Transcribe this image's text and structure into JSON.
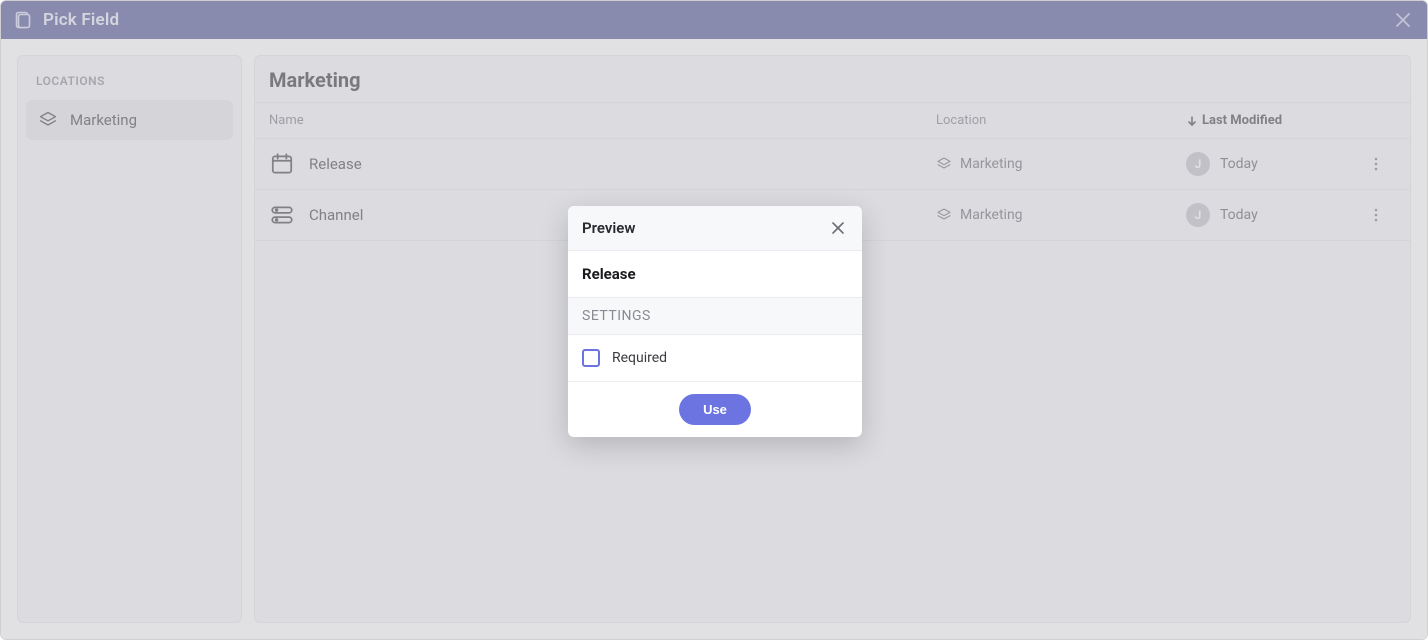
{
  "titlebar": {
    "title": "Pick Field"
  },
  "sidebar": {
    "header": "LOCATIONS",
    "items": [
      {
        "label": "Marketing"
      }
    ]
  },
  "main": {
    "heading": "Marketing",
    "columns": {
      "name": "Name",
      "location": "Location",
      "lastModified": "Last Modified"
    },
    "rows": [
      {
        "name": "Release",
        "icon": "date",
        "location": "Marketing",
        "modified": "Today",
        "avatar": "J"
      },
      {
        "name": "Channel",
        "icon": "list",
        "location": "Marketing",
        "modified": "Today",
        "avatar": "J"
      }
    ]
  },
  "popover": {
    "header": "Preview",
    "itemName": "Release",
    "settingsLabel": "SETTINGS",
    "settings": [
      {
        "label": "Required",
        "checked": false
      }
    ],
    "cta": "Use"
  }
}
